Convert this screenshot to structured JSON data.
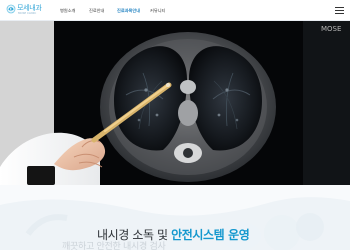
{
  "header": {
    "logo": {
      "name": "모세내과",
      "subtitle": "MOSE CLINIC"
    },
    "nav": [
      {
        "label": "병원소개"
      },
      {
        "label": "진료안내"
      },
      {
        "label": "진료과목안내"
      },
      {
        "label": "커뮤니티"
      }
    ],
    "menu_icon": "hamburger-icon"
  },
  "hero": {
    "description": "chest CT scan with pen pointer"
  },
  "section": {
    "title_prefix": "내시경 소독 및 ",
    "title_highlight": "안전시스템 운영",
    "subtitle_partial": "깨끗하고 안전한 내시경 검사"
  },
  "colors": {
    "accent": "#1498ce",
    "nav_active": "#2d89c5",
    "text": "#2c3136"
  }
}
